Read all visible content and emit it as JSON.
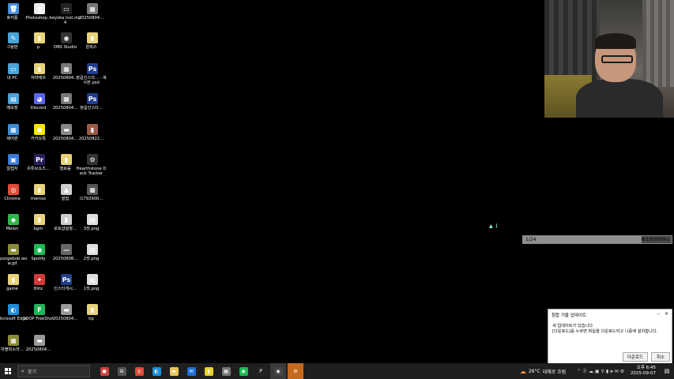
{
  "desktop": {
    "icons": [
      {
        "label": "휴지통",
        "glyph": "🗑",
        "color": "#4a8fd8"
      },
      {
        "label": "Photoshop...",
        "glyph": "▮",
        "color": "#eeeeee"
      },
      {
        "label": "heyoka inst.mp4",
        "glyph": "▭",
        "color": "#222222"
      },
      {
        "label": "20250804...",
        "glyph": "▦",
        "color": "#777777"
      },
      {
        "label": "그림판",
        "glyph": "✎",
        "color": "#4aa3d8"
      },
      {
        "label": "p",
        "glyph": "▮",
        "color": "#e8d27a"
      },
      {
        "label": "OBS Studio",
        "glyph": "◉",
        "color": "#333333"
      },
      {
        "label": "원피스",
        "glyph": "▮",
        "color": "#e8d27a"
      },
      {
        "label": "내 PC",
        "glyph": "▭",
        "color": "#4aa3d8"
      },
      {
        "label": "자마에프",
        "glyph": "▮",
        "color": "#e8d27a"
      },
      {
        "label": "20250804...",
        "glyph": "▦",
        "color": "#777777"
      },
      {
        "label": "정길인스타...\n- 복사본.psd",
        "glyph": "Ps",
        "color": "#1f3f8a"
      },
      {
        "label": "메모장",
        "glyph": "▤",
        "color": "#4aa3d8"
      },
      {
        "label": "Discord",
        "glyph": "◕",
        "color": "#5865f2"
      },
      {
        "label": "20250804...",
        "glyph": "▦",
        "color": "#777777"
      },
      {
        "label": "정길인스타...",
        "glyph": "Ps",
        "color": "#1f3f8a"
      },
      {
        "label": "제어판",
        "glyph": "▦",
        "color": "#3e8cd6"
      },
      {
        "label": "카카오톡",
        "glyph": "●",
        "color": "#f7e600"
      },
      {
        "label": "20250804...",
        "glyph": "▬",
        "color": "#888888"
      },
      {
        "label": "20250822...",
        "glyph": "▮",
        "color": "#9a5a48"
      },
      {
        "label": "알캡처",
        "glyph": "▣",
        "color": "#3a7bd5"
      },
      {
        "label": "유튜브쇼츠...",
        "glyph": "Pr",
        "color": "#2a1f5c"
      },
      {
        "label": "행로움",
        "glyph": "▮",
        "color": "#e8d27a"
      },
      {
        "label": "Hearthstone Deck Tracker",
        "glyph": "⚙",
        "color": "#333333"
      },
      {
        "label": "Chrome",
        "glyph": "◎",
        "color": "#e04a3a"
      },
      {
        "label": "memos",
        "glyph": "▮",
        "color": "#e8d27a"
      },
      {
        "label": "발칩",
        "glyph": "▲",
        "color": "#cccccc"
      },
      {
        "label": "i1792900...",
        "glyph": "▦",
        "color": "#555555"
      },
      {
        "label": "Melon",
        "glyph": "◆",
        "color": "#2fb64a"
      },
      {
        "label": "bgm",
        "glyph": "▮",
        "color": "#e8d27a"
      },
      {
        "label": "포토샵설정...",
        "glyph": "▮",
        "color": "#cccccc"
      },
      {
        "label": "3컷.png",
        "glyph": "▤",
        "color": "#dddddd"
      },
      {
        "label": "spongebob wow.gif",
        "glyph": "▬",
        "color": "#8a8a3a"
      },
      {
        "label": "Spotify",
        "glyph": "◉",
        "color": "#1db954"
      },
      {
        "label": "20250808...",
        "glyph": "—",
        "color": "#666666"
      },
      {
        "label": "2컷.png",
        "glyph": "▤",
        "color": "#dddddd"
      },
      {
        "label": "game",
        "glyph": "▮",
        "color": "#e8d27a"
      },
      {
        "label": "Blitz",
        "glyph": "✦",
        "color": "#d33a3a"
      },
      {
        "label": "인스타게시...",
        "glyph": "Ps",
        "color": "#1f3f8a"
      },
      {
        "label": "1컷.png",
        "glyph": "▤",
        "color": "#dddddd"
      },
      {
        "label": "Microsoft Edge",
        "glyph": "◐",
        "color": "#1f8fd8"
      },
      {
        "label": "SOOP FreeShot",
        "glyph": "F",
        "color": "#1fb55a"
      },
      {
        "label": "20250804...",
        "glyph": "▬",
        "color": "#999999"
      },
      {
        "label": "tip",
        "glyph": "▮",
        "color": "#e8d27a"
      },
      {
        "label": "마블피소라...",
        "glyph": "▦",
        "color": "#8a8a3a"
      },
      {
        "label": "20250804...",
        "glyph": "▬",
        "color": "#999999"
      }
    ]
  },
  "indicator": {
    "arrow": "▲",
    "count": "1"
  },
  "progress": {
    "left_text": "1/24",
    "right_text": "8/10(000%)",
    "value": 0.8
  },
  "popup": {
    "title": "첨합 거울 업데이트",
    "minimize": "–",
    "close": "×",
    "message_line1": "새 업데이트가 있습니다.",
    "message_line2": "[다운로드]를 누르면 파일을 다운로드하고 나중에 설치합니다.",
    "download_label": "다운로드",
    "cancel_label": "취소"
  },
  "taskbar": {
    "search_placeholder": "찾기",
    "apps": [
      {
        "name": "widgets",
        "glyph": "●",
        "color": "#c44"
      },
      {
        "name": "task-view",
        "glyph": "⊟",
        "color": "#555"
      },
      {
        "name": "chrome",
        "glyph": "◎",
        "color": "#e04a3a"
      },
      {
        "name": "edge",
        "glyph": "◐",
        "color": "#1f8fd8"
      },
      {
        "name": "explorer",
        "glyph": "▬",
        "color": "#e8c45a"
      },
      {
        "name": "outlook",
        "glyph": "✉",
        "color": "#1f6fd8"
      },
      {
        "name": "sticky",
        "glyph": "▮",
        "color": "#e8d22a"
      },
      {
        "name": "calculator",
        "glyph": "▦",
        "color": "#777"
      },
      {
        "name": "spotify",
        "glyph": "◉",
        "color": "#1db954"
      },
      {
        "name": "pycharm",
        "glyph": "P",
        "color": "#222"
      },
      {
        "name": "obs",
        "glyph": "◉",
        "color": "#444"
      },
      {
        "name": "hdt",
        "glyph": "⚙",
        "color": "#c36a1f"
      }
    ],
    "weather_temp": "26°C",
    "weather_text": "대체로 흐림",
    "sys_icons": "⌃ ⓔ ☁ ▣ ⚲ ▮ 🕪 ✉ ⚙",
    "time": "오후 6:45",
    "date": "2025-09-07"
  }
}
